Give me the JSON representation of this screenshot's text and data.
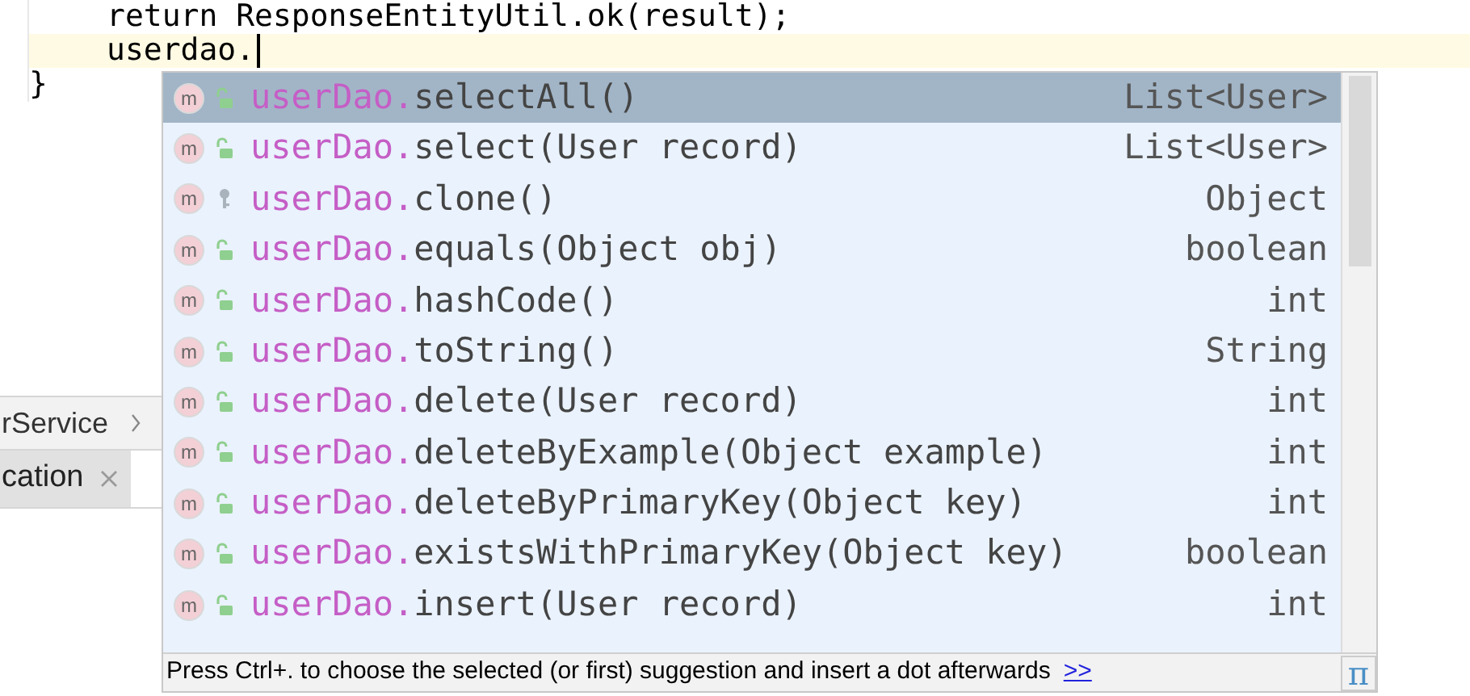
{
  "editor": {
    "lines": [
      {
        "text": "return ResponseEntityUtil.ok(result);",
        "current": false
      },
      {
        "text": "userdao.",
        "current": true
      },
      {
        "text": "}",
        "current": false
      }
    ]
  },
  "tool_tabs": [
    {
      "label": "rService",
      "kind": "breadcrumb"
    },
    {
      "label": "cation",
      "kind": "closable"
    }
  ],
  "completion": {
    "items": [
      {
        "icon": "m",
        "qualifier": "userDao.",
        "name": "selectAll()",
        "type": "List<User>",
        "kind": "public",
        "selected": true
      },
      {
        "icon": "m",
        "qualifier": "userDao.",
        "name": "select(User record)",
        "type": "List<User>",
        "kind": "public",
        "selected": false
      },
      {
        "icon": "m",
        "qualifier": "userDao.",
        "name": "clone()",
        "type": "Object",
        "kind": "protected",
        "selected": false
      },
      {
        "icon": "m",
        "qualifier": "userDao.",
        "name": "equals(Object obj)",
        "type": "boolean",
        "kind": "public",
        "selected": false
      },
      {
        "icon": "m",
        "qualifier": "userDao.",
        "name": "hashCode()",
        "type": "int",
        "kind": "public",
        "selected": false
      },
      {
        "icon": "m",
        "qualifier": "userDao.",
        "name": "toString()",
        "type": "String",
        "kind": "public",
        "selected": false
      },
      {
        "icon": "m",
        "qualifier": "userDao.",
        "name": "delete(User record)",
        "type": "int",
        "kind": "public",
        "selected": false
      },
      {
        "icon": "m",
        "qualifier": "userDao.",
        "name": "deleteByExample(Object example)",
        "type": "int",
        "kind": "public",
        "selected": false
      },
      {
        "icon": "m",
        "qualifier": "userDao.",
        "name": "deleteByPrimaryKey(Object key)",
        "type": "int",
        "kind": "public",
        "selected": false
      },
      {
        "icon": "m",
        "qualifier": "userDao.",
        "name": "existsWithPrimaryKey(Object key)",
        "type": "boolean",
        "kind": "public",
        "selected": false
      },
      {
        "icon": "m",
        "qualifier": "userDao.",
        "name": "insert(User record)",
        "type": "int",
        "kind": "public",
        "selected": false
      }
    ],
    "hint": "Press Ctrl+. to choose the selected (or first) suggestion and insert a dot afterwards",
    "hint_link": ">>",
    "pi": "π"
  }
}
